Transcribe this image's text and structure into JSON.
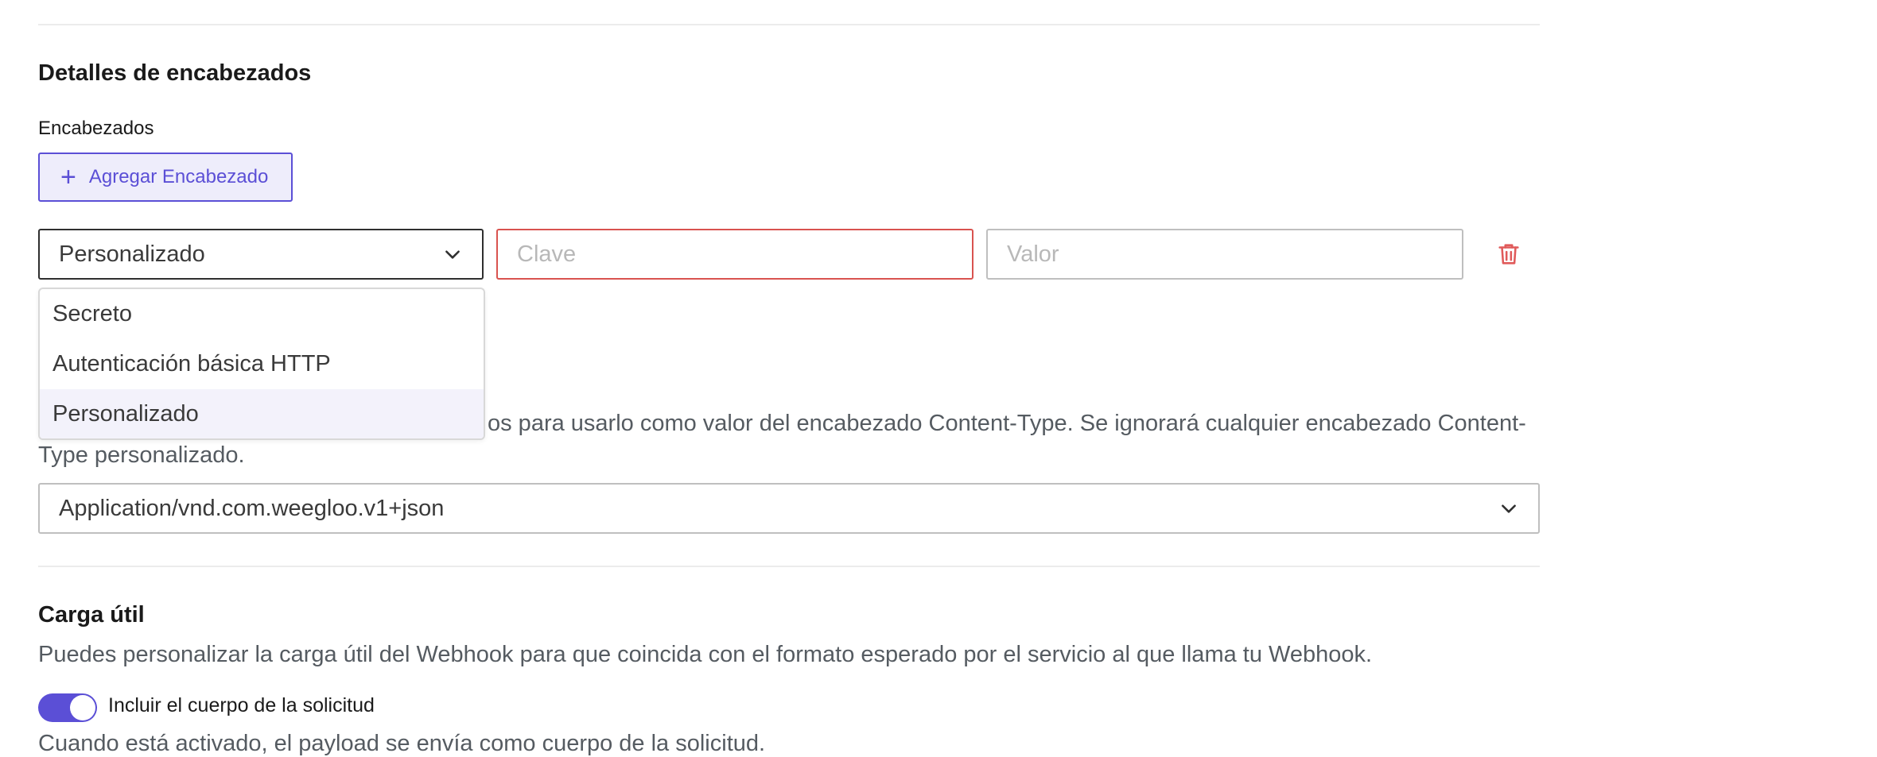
{
  "headers_section": {
    "title": "Detalles de encabezados",
    "headers_label": "Encabezados",
    "add_button_label": "Agregar Encabezado",
    "add_button_icon": "plus-icon",
    "header_row": {
      "type_selected": "Personalizado",
      "key_placeholder": "Clave",
      "value_placeholder": "Valor",
      "delete_icon": "trash-icon"
    },
    "type_options": [
      "Secreto",
      "Autenticación básica HTTP",
      "Personalizado"
    ]
  },
  "content_type": {
    "description_visible": "os para usarlo como valor del encabezado Content-Type. Se ignorará cualquier encabezado Content-",
    "description_line2": "Type personalizado.",
    "selected": "Application/vnd.com.weegloo.v1+json"
  },
  "payload_section": {
    "title": "Carga útil",
    "description": "Puedes personalizar la carga útil del Webhook para que coincida con el formato esperado por el servicio al que llama tu Webhook.",
    "toggle_label": "Incluir el cuerpo de la solicitud",
    "toggle_on": true,
    "toggle_help": "Cuando está activado, el payload se envía como cuerpo de la solicitud."
  },
  "colors": {
    "accent": "#5b4fd6",
    "error": "#d9534f",
    "trash": "#e05a5a"
  }
}
